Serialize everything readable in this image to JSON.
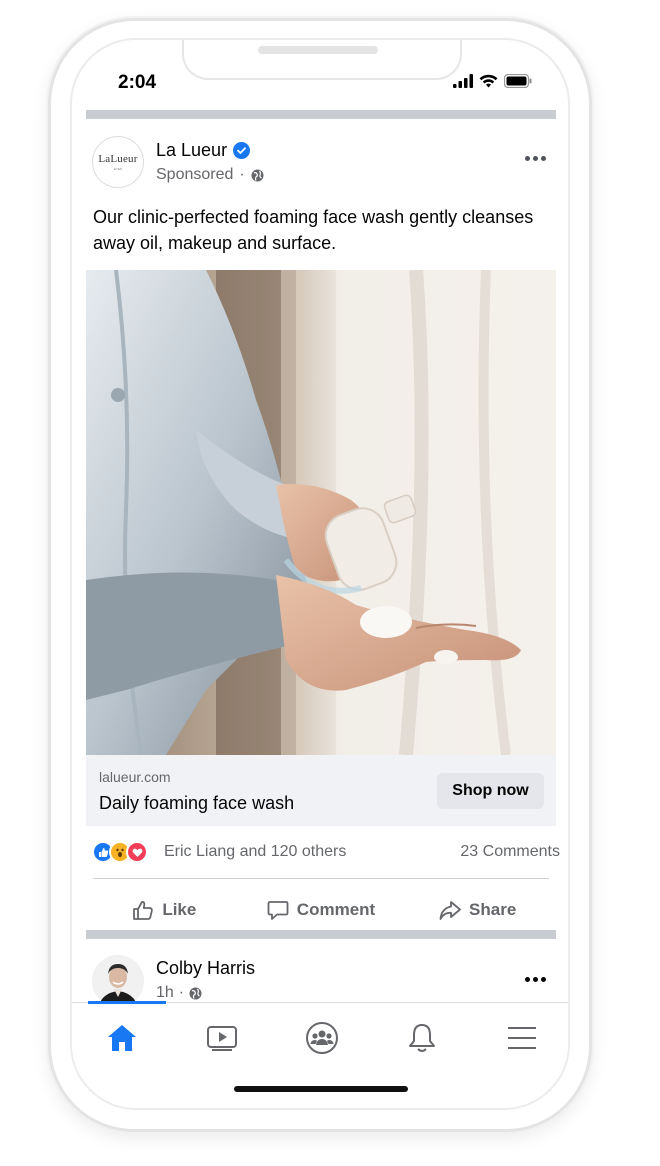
{
  "status_bar": {
    "time": "2:04"
  },
  "ad_post": {
    "page_name": "La Lueur",
    "avatar_logo": "LaLueur",
    "avatar_sub": "EYES",
    "sponsored_label": "Sponsored",
    "text": "Our clinic-perfected foaming face wash gently cleanses away oil, makeup and surface.",
    "link_domain": "lalueur.com",
    "link_title": "Daily foaming face wash",
    "cta_label": "Shop now",
    "reactors": "Eric Liang and 120 others",
    "comments_count": "23 Comments",
    "actions": {
      "like": "Like",
      "comment": "Comment",
      "share": "Share"
    }
  },
  "next_post": {
    "author": "Colby Harris",
    "time": "1h"
  },
  "colors": {
    "accent": "#1877f2",
    "secondary_text": "#65676b",
    "separator": "#c9ccd1",
    "link_bg": "#f0f2f5"
  },
  "icons": [
    "signal-icon",
    "wifi-icon",
    "battery-icon",
    "verified-icon",
    "globe-icon",
    "more-icon",
    "like-reaction-icon",
    "wow-reaction-icon",
    "love-reaction-icon",
    "thumb-up-icon",
    "comment-icon",
    "share-icon",
    "home-icon",
    "watch-icon",
    "groups-icon",
    "bell-icon",
    "menu-icon"
  ]
}
